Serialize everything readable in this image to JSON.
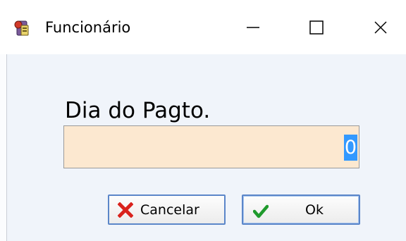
{
  "window": {
    "title": "Funcionário"
  },
  "form": {
    "label": "Dia do Pagto.",
    "value": "0"
  },
  "buttons": {
    "cancel_label": "Cancelar",
    "ok_label": "Ok"
  },
  "icons": {
    "app": "app-icon",
    "minimize": "minimize-icon",
    "maximize": "maximize-icon",
    "close": "close-icon",
    "cancel": "red-x-icon",
    "ok": "green-check-icon"
  },
  "colors": {
    "input_background": "#fce8d0",
    "selection": "#3399ff",
    "button_border": "#5b86c9",
    "cancel_icon": "#d9221c",
    "ok_icon": "#1f9a2c"
  }
}
